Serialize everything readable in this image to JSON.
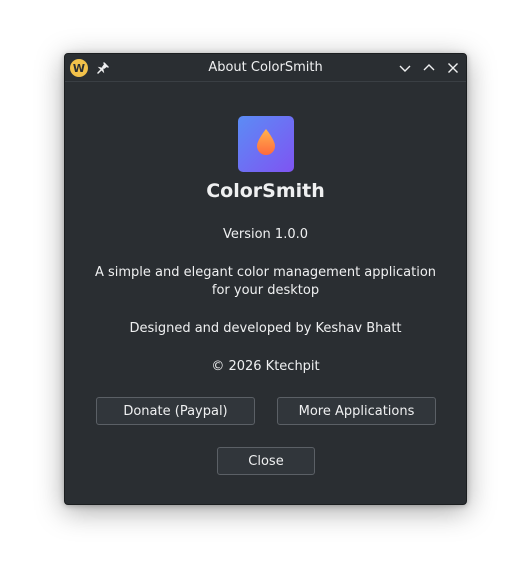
{
  "window": {
    "title": "About ColorSmith",
    "app_icon": "app-logo-icon",
    "pin_icon": "pin-icon",
    "controls": [
      "minimize-icon",
      "maximize-icon",
      "close-icon"
    ]
  },
  "about": {
    "logo_icon": "droplet-icon",
    "app_name": "ColorSmith",
    "version": "Version 1.0.0",
    "description": "A simple and elegant color management application for your desktop",
    "credits": "Designed and developed by Keshav Bhatt",
    "copyright": "© 2026 Ktechpit"
  },
  "buttons": {
    "donate": "Donate (Paypal)",
    "more_apps": "More Applications",
    "close": "Close"
  },
  "colors": {
    "window_bg": "#2a2e32",
    "text": "#eff0f1",
    "logo_gradient_start": "#5b8cf5",
    "logo_gradient_end": "#7f54f2",
    "droplet_start": "#ffb34d",
    "droplet_end": "#ff6a3d",
    "app_icon": "#f2c14a"
  }
}
